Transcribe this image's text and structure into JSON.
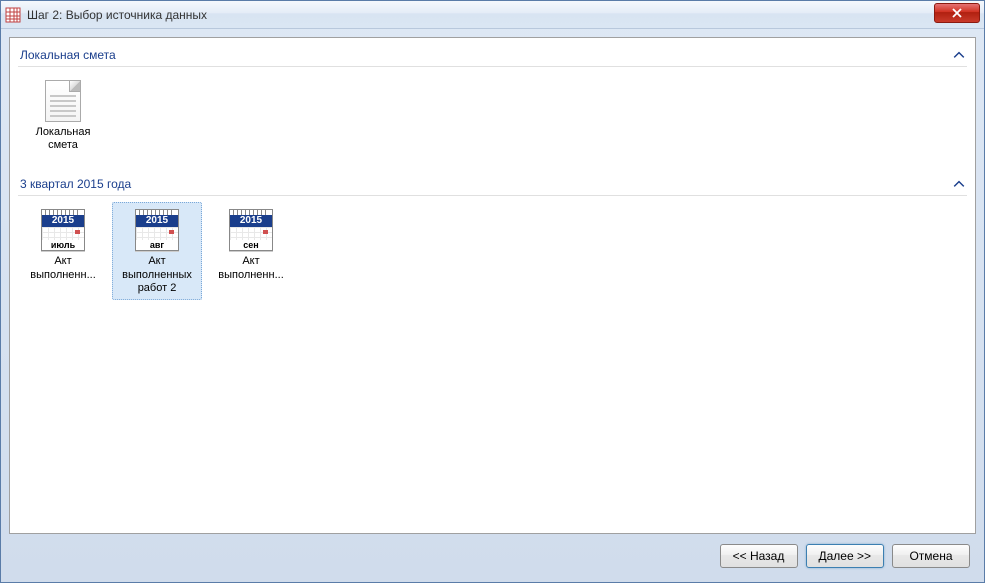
{
  "window": {
    "title": "Шаг 2: Выбор источника данных"
  },
  "sections": [
    {
      "title": "Локальная смета",
      "expanded": true,
      "items": [
        {
          "type": "doc",
          "label": "Локальная смета",
          "selected": false
        }
      ]
    },
    {
      "title": "3 квартал 2015 года",
      "expanded": true,
      "items": [
        {
          "type": "cal",
          "year": "2015",
          "month": "июль",
          "label": "Акт выполненн...",
          "selected": false
        },
        {
          "type": "cal",
          "year": "2015",
          "month": "авг",
          "label": "Акт выполненных работ 2",
          "selected": true
        },
        {
          "type": "cal",
          "year": "2015",
          "month": "сен",
          "label": "Акт выполненн...",
          "selected": false
        }
      ]
    }
  ],
  "buttons": {
    "back": "<< Назад",
    "next": "Далее >>",
    "cancel": "Отмена"
  }
}
